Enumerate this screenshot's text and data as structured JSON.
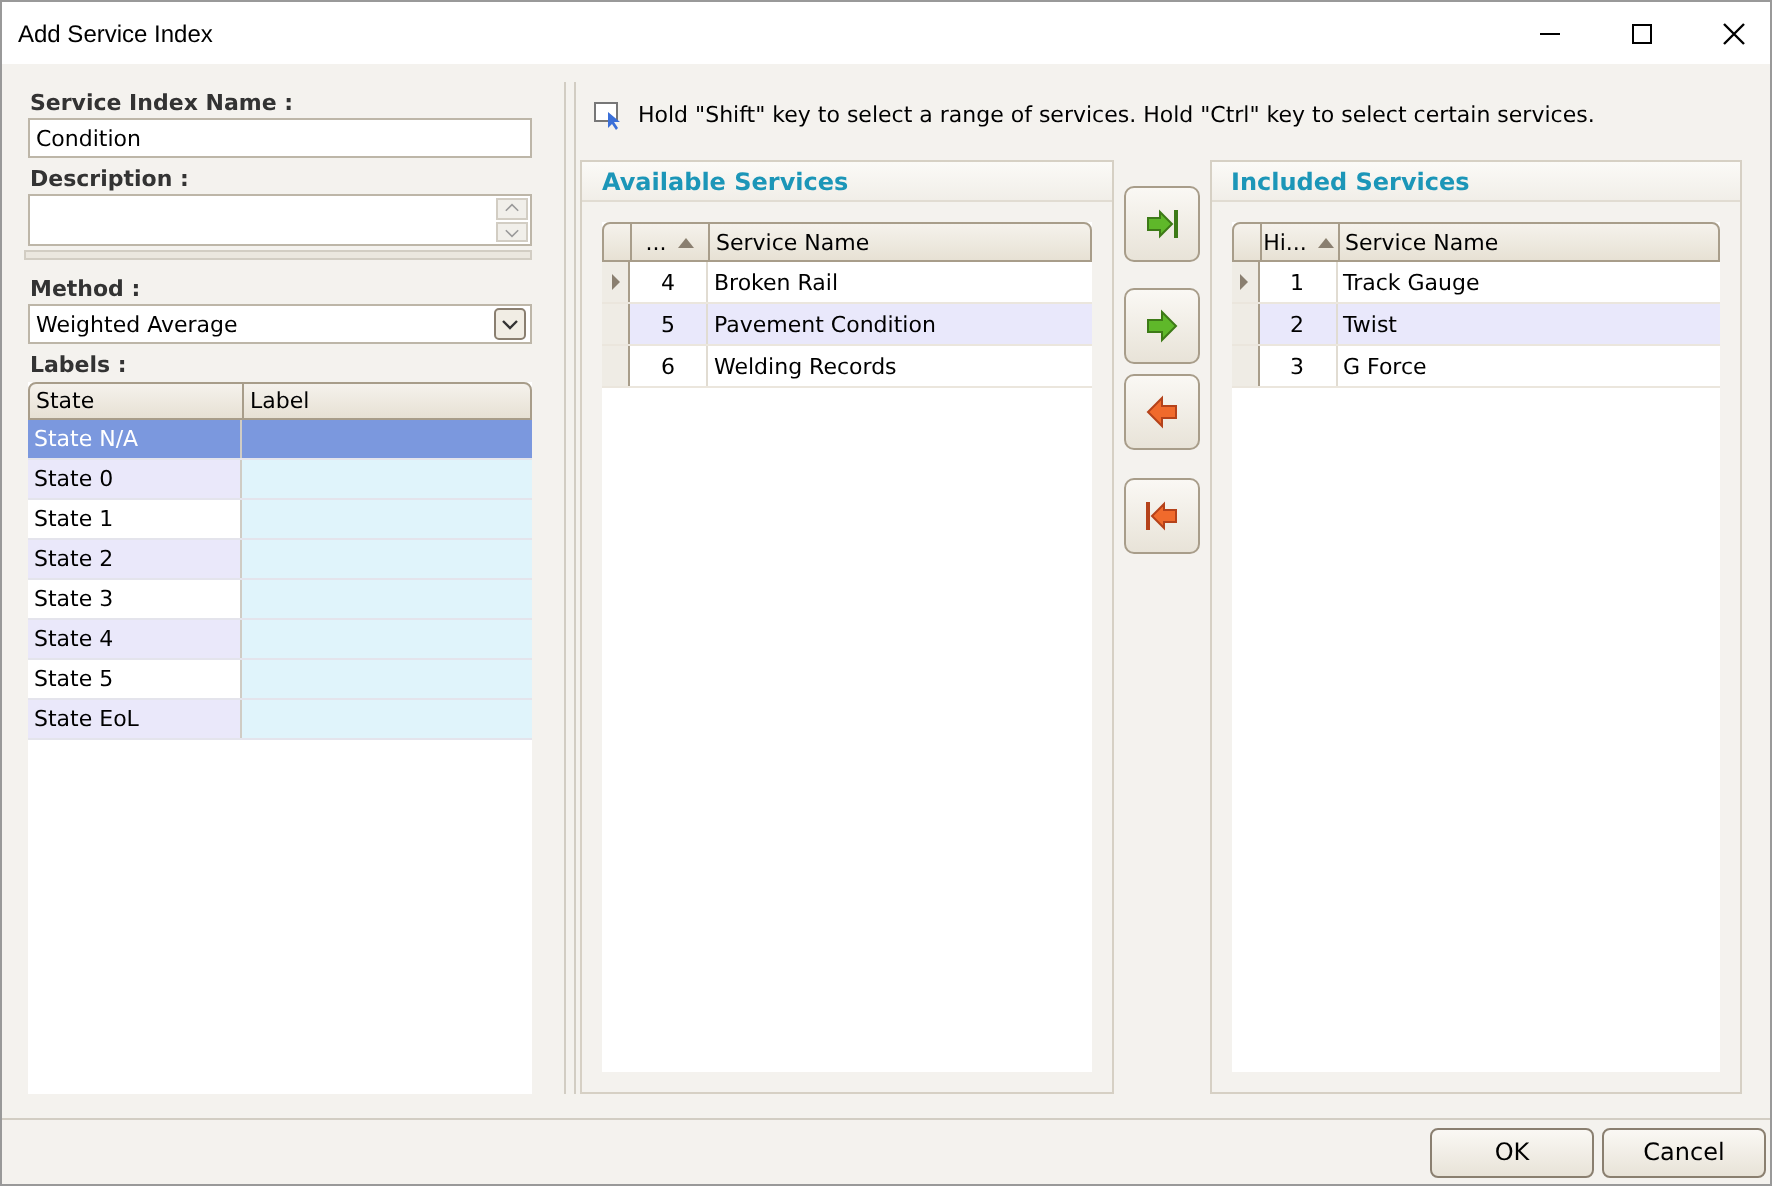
{
  "window": {
    "title": "Add Service Index"
  },
  "form": {
    "name_label": "Service Index Name :",
    "name_value": "Condition",
    "description_label": "Description :",
    "method_label": "Method :",
    "method_value": "Weighted Average",
    "labels_label": "Labels :"
  },
  "labels_table": {
    "columns": [
      "State",
      "Label"
    ],
    "rows": [
      {
        "state": "State N/A",
        "selected": true
      },
      {
        "state": "State 0",
        "selected": false
      },
      {
        "state": "State 1",
        "selected": false
      },
      {
        "state": "State 2",
        "selected": false
      },
      {
        "state": "State 3",
        "selected": false
      },
      {
        "state": "State 4",
        "selected": false
      },
      {
        "state": "State 5",
        "selected": false
      },
      {
        "state": "State EoL",
        "selected": false
      }
    ]
  },
  "hint": "Hold \"Shift\" key to select a range of services. Hold \"Ctrl\" key to select certain services.",
  "available": {
    "title": "Available Services",
    "columns": [
      "...",
      "Service Name"
    ],
    "rows": [
      {
        "id": "4",
        "name": "Broken Rail",
        "current": true
      },
      {
        "id": "5",
        "name": "Pavement Condition",
        "current": false
      },
      {
        "id": "6",
        "name": "Welding Records",
        "current": false
      }
    ]
  },
  "included": {
    "title": "Included Services",
    "columns": [
      "Hi...",
      "Service Name"
    ],
    "rows": [
      {
        "id": "1",
        "name": "Track Gauge",
        "current": true
      },
      {
        "id": "2",
        "name": "Twist",
        "current": false
      },
      {
        "id": "3",
        "name": "G Force",
        "current": false
      }
    ]
  },
  "move_buttons": [
    {
      "kind": "add-all"
    },
    {
      "kind": "add"
    },
    {
      "kind": "remove"
    },
    {
      "kind": "remove-all"
    }
  ],
  "buttons": [
    "OK",
    "Cancel"
  ]
}
